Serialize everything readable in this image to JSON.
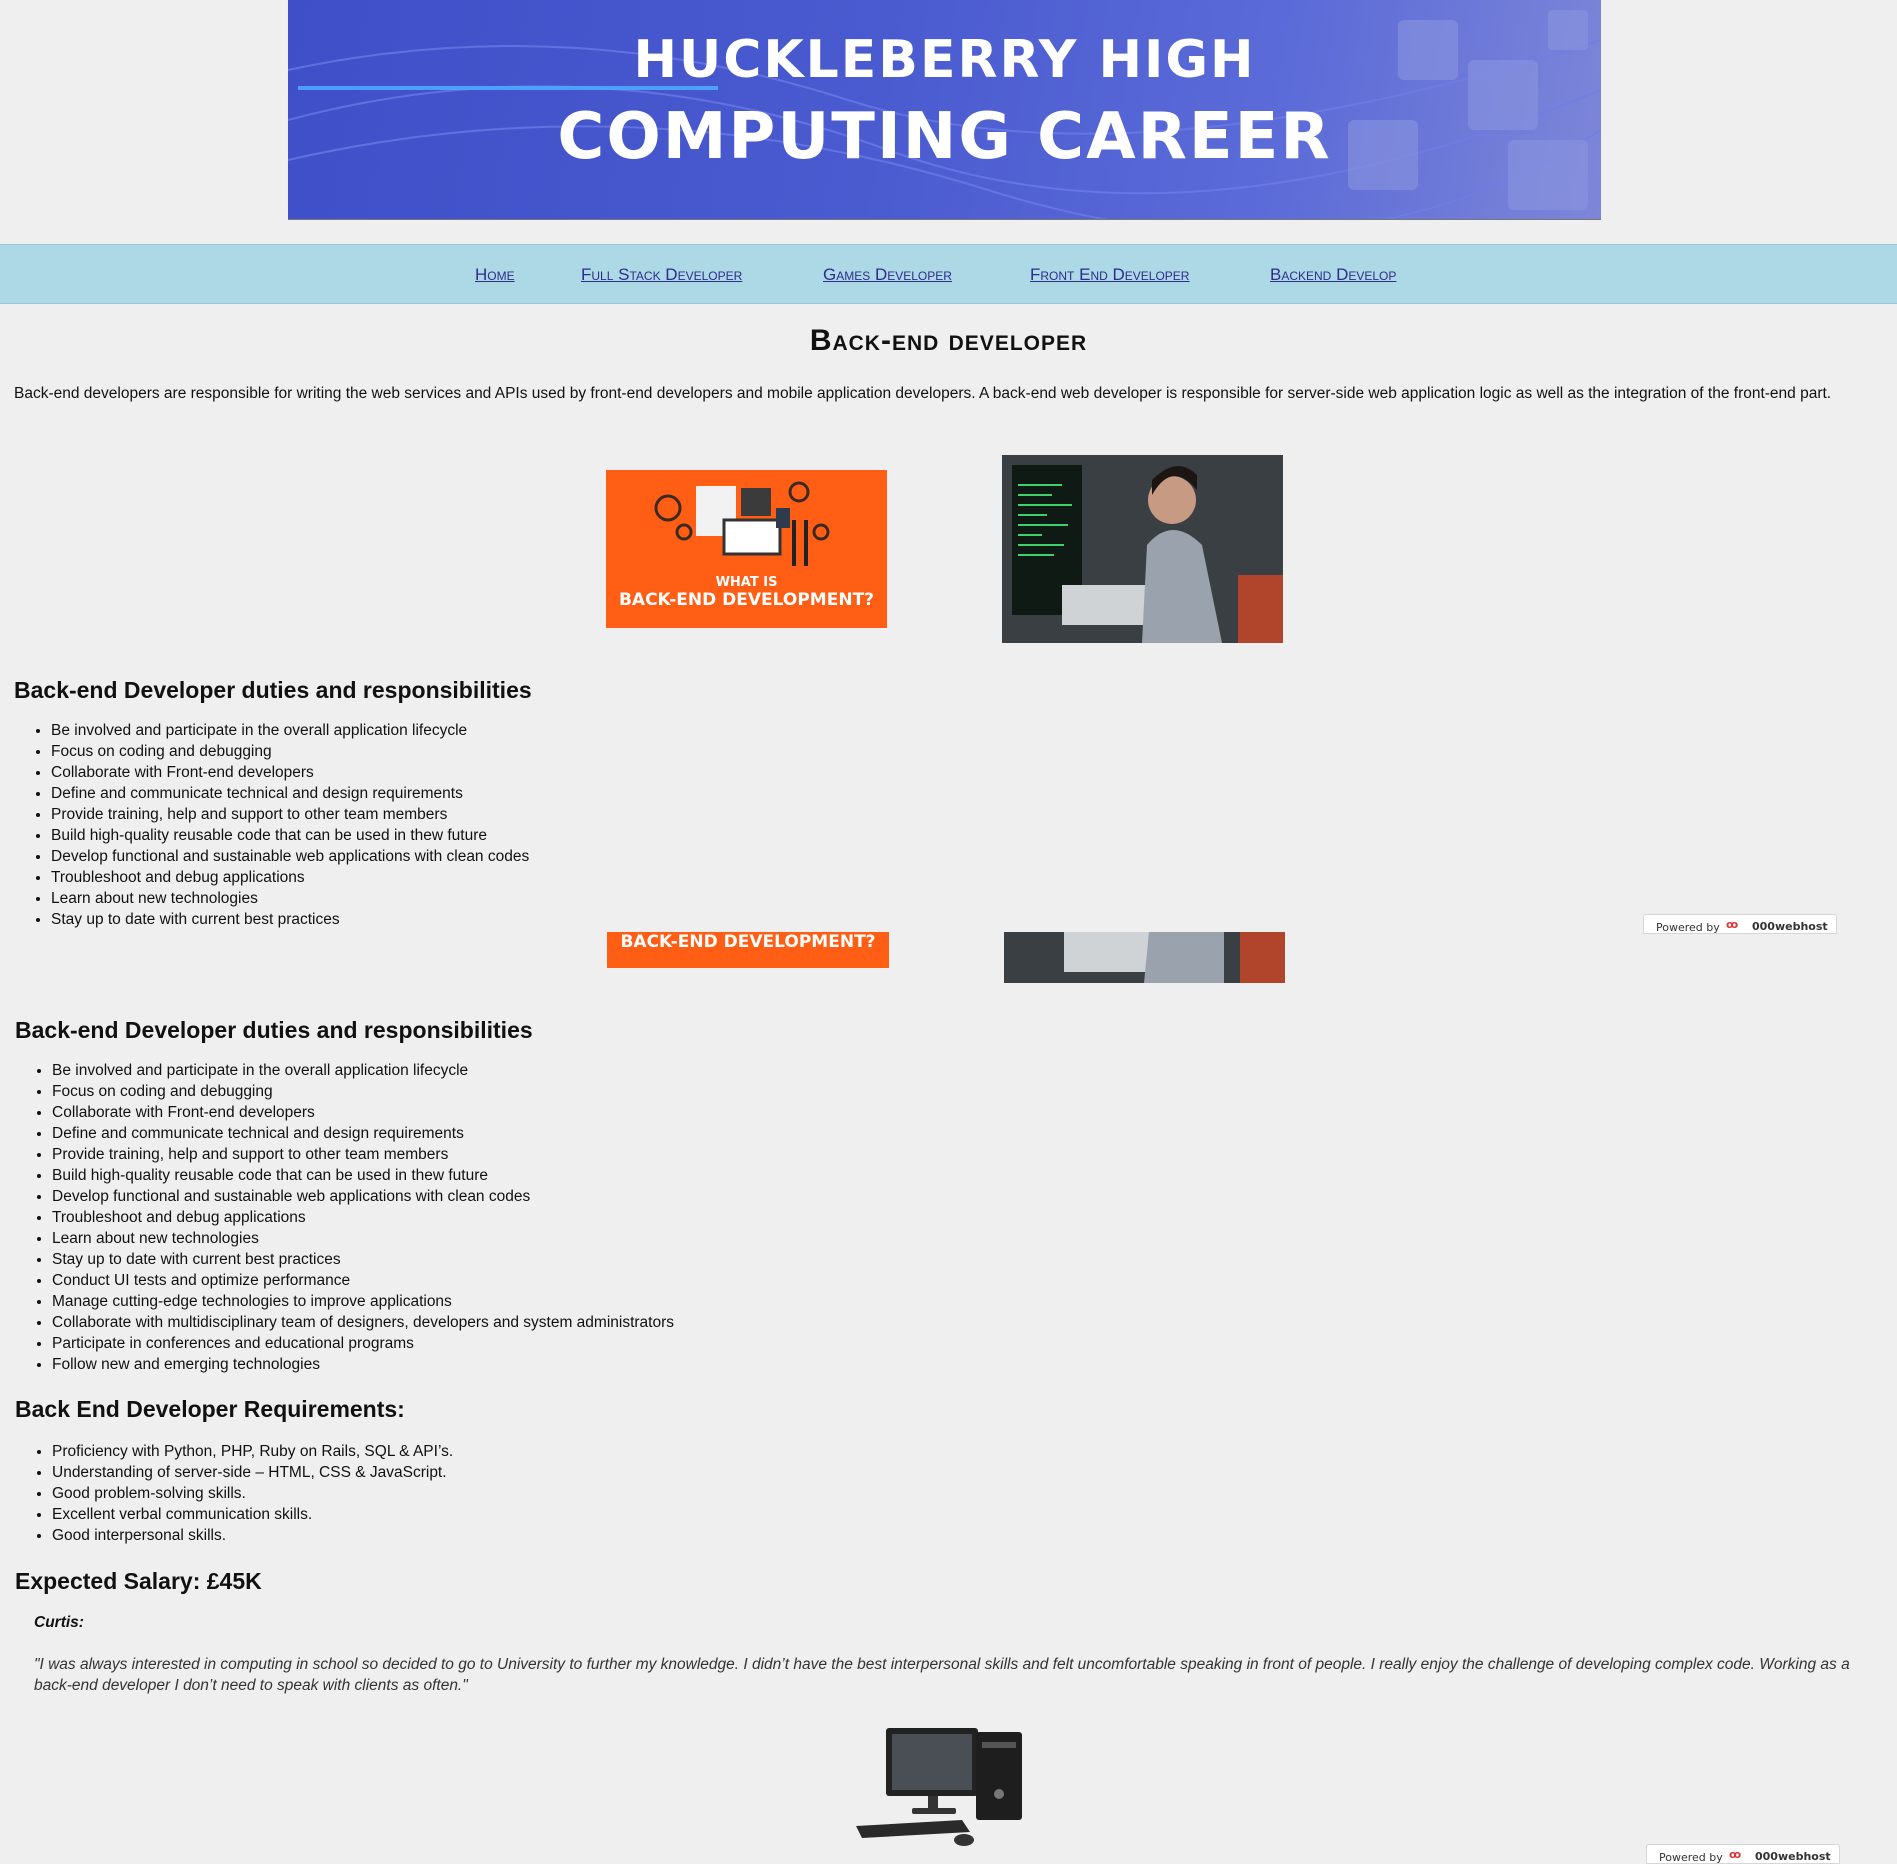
{
  "banner": {
    "line1": "HUCKLEBERRY HIGH",
    "line2": "COMPUTING CAREER"
  },
  "nav": {
    "items": [
      "Home",
      "Full Stack Developer",
      "Games Developer",
      "Front End Developer",
      "Backend Develop"
    ]
  },
  "page": {
    "title": "Back-end developer",
    "intro": "Back-end developers are responsible for writing the web services and APIs used by front-end developers and mobile application developers. A back-end web developer is responsible for server-side web application logic as well as the integration of the front-end part."
  },
  "images": {
    "orange_small": "WHAT IS",
    "orange_big": "BACK-END DEVELOPMENT?"
  },
  "duties": {
    "heading": "Back-end Developer duties and responsibilities",
    "items": [
      "Be involved and participate in the overall application lifecycle",
      "Focus on coding and debugging",
      "Collaborate with Front-end developers",
      "Define and communicate technical and design requirements",
      "Provide training, help and support to other team members",
      "Build high-quality reusable code that can be used in thew future",
      "Develop functional and sustainable web applications with clean codes",
      "Troubleshoot and debug applications",
      "Learn about new technologies",
      "Stay up to date with current best practices",
      "Conduct UI tests and optimize performance",
      "Manage cutting-edge technologies to improve applications",
      "Collaborate with multidisciplinary team of designers, developers and system administrators",
      "Participate in conferences and educational programs",
      "Follow new and emerging technologies"
    ]
  },
  "requirements": {
    "heading": "Back End Developer Requirements:",
    "items": [
      "Proficiency with Python, PHP, Ruby on Rails, SQL & API’s.",
      "Understanding of server-side – HTML, CSS & JavaScript.",
      "Good problem-solving skills.",
      "Excellent verbal communication skills.",
      "Good interpersonal skills."
    ]
  },
  "salary": {
    "heading": "Expected Salary: £45K"
  },
  "testimonial": {
    "name": "Curtis:",
    "quote": "\"I was always interested in computing in school so decided to go to University to further my knowledge. I didn’t have the best interpersonal skills and felt uncomfortable speaking in front of people. I really enjoy the challenge of developing complex code. Working as a back-end developer I don’t need to speak with clients as often.\""
  },
  "badge": {
    "powered": "Powered by",
    "brand": "000webhost"
  },
  "colors": {
    "nav_bg": "#add8e6",
    "banner": "#4a5bd0",
    "orange": "#ff5e14"
  }
}
